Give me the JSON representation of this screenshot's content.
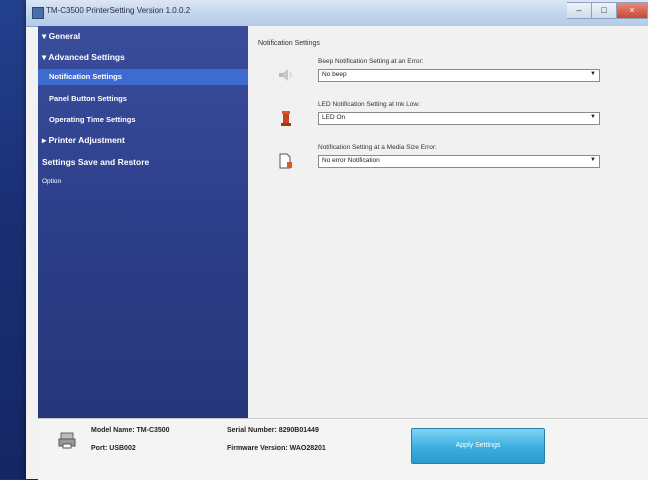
{
  "window": {
    "title": "TM-C3500 PrinterSetting Version 1.0.0.2",
    "controls": [
      "–",
      "□",
      "×"
    ]
  },
  "sidebar": {
    "items": [
      {
        "label": "▾ General"
      },
      {
        "label": "▾ Advanced Settings"
      },
      {
        "label": "Notification Settings",
        "active": true
      },
      {
        "label": "Panel Button Settings"
      },
      {
        "label": "Operating Time Settings"
      },
      {
        "label": "▸ Printer Adjustment"
      },
      {
        "label": "Settings Save and Restore"
      },
      {
        "label": "Option"
      }
    ]
  },
  "content": {
    "section_title": "Notification Settings",
    "settings": [
      {
        "label": "Beep Notification Setting at an Error:",
        "value": "No beep",
        "icon": "speaker-icon"
      },
      {
        "label": "LED Notification Setting at Ink Low:",
        "value": "LED On",
        "icon": "ink-cartridge-icon"
      },
      {
        "label": "Notification Setting at a Media Size Error:",
        "value": "No error Notification",
        "icon": "media-size-icon"
      }
    ]
  },
  "footer": {
    "model_name": "Model Name: TM-C3500",
    "port": "Port: USB002",
    "serial_number": "Serial Number: 8290B01449",
    "firmware_version": "Firmware Version: WAO28201",
    "apply_label": "Apply Settings"
  },
  "colors": {
    "accent": "#3e6bcf",
    "sidebar": "#2d3f8a",
    "apply_button": "#3aaede"
  }
}
